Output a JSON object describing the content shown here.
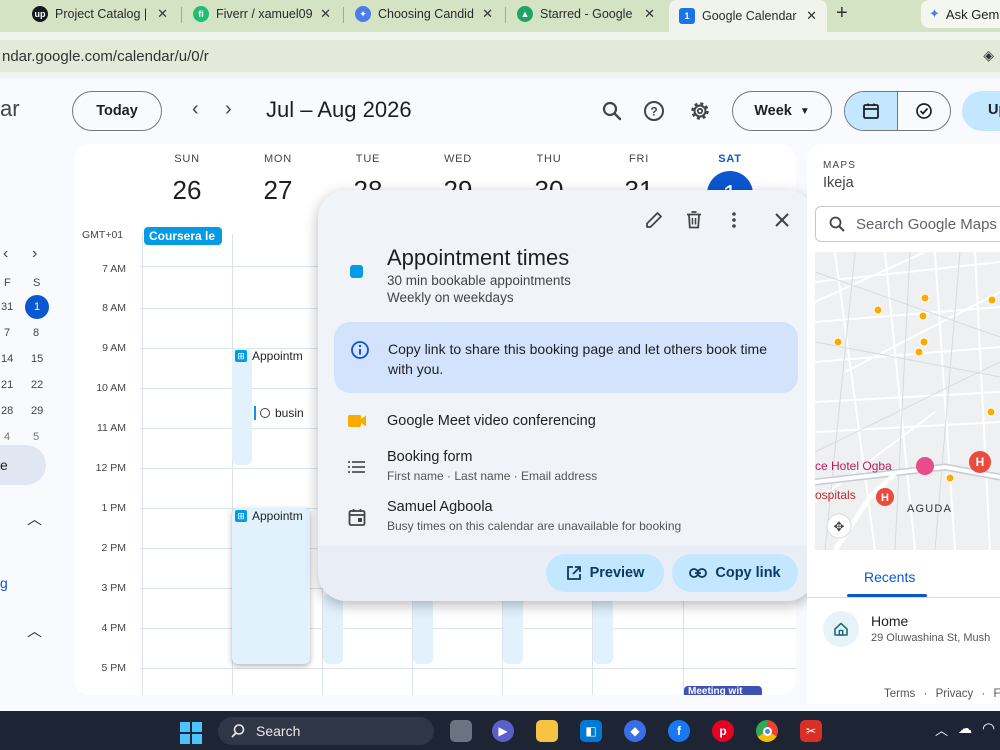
{
  "browser": {
    "tabs": [
      {
        "title": "Project Catalog |",
        "favicon": "upwork-icon",
        "color": "#14181c",
        "glyph": "up"
      },
      {
        "title": "Fiverr / xamuel09",
        "favicon": "fiverr-icon",
        "color": "#1dbf73",
        "glyph": "fi"
      },
      {
        "title": "Choosing Candid",
        "favicon": "gemini-icon",
        "color": "#4b7bec",
        "glyph": "✦"
      },
      {
        "title": "Starred - Google",
        "favicon": "google-drive-icon",
        "color": "#1fa463",
        "glyph": "▲"
      },
      {
        "title": "Google Calendar",
        "favicon": "google-calendar-icon",
        "color": "#1a73e8",
        "glyph": "1"
      }
    ],
    "close_glyph": "✕",
    "new_tab_glyph": "+",
    "gemini_button": "Ask Gem",
    "url": "ndar.google.com/calendar/u/0/r"
  },
  "calendar": {
    "brand_fragment": "ar",
    "today_label": "Today",
    "prev_glyph": "‹",
    "next_glyph": "›",
    "date_range": "Jul – Aug 2026",
    "view_label": "Week",
    "create_fragment": "Up",
    "timezone": "GMT+01",
    "days": [
      {
        "name": "SUN",
        "date": "26"
      },
      {
        "name": "MON",
        "date": "27"
      },
      {
        "name": "TUE",
        "date": "28"
      },
      {
        "name": "WED",
        "date": "29"
      },
      {
        "name": "THU",
        "date": "30"
      },
      {
        "name": "FRI",
        "date": "31"
      },
      {
        "name": "SAT",
        "date": "1"
      }
    ],
    "allday_event": "Coursera le",
    "times": [
      "7 AM",
      "8 AM",
      "9 AM",
      "10 AM",
      "11 AM",
      "12 PM",
      "1 PM",
      "2 PM",
      "3 PM",
      "4 PM",
      "5 PM"
    ],
    "events": {
      "appt_morning": "Appointm",
      "business": "busin",
      "appt_afternoon": "Appointm",
      "meeting": "Meeting wit"
    }
  },
  "mini_calendar": {
    "prev": "‹",
    "next": "›",
    "col_f": "F",
    "col_s": "S",
    "rows": [
      [
        "31",
        "1"
      ],
      [
        "7",
        "8"
      ],
      [
        "14",
        "15"
      ],
      [
        "21",
        "22"
      ],
      [
        "28",
        "29"
      ],
      [
        "4",
        "5"
      ]
    ],
    "selected_fragment": "e",
    "link_fragment": "g"
  },
  "popover": {
    "title": "Appointment times",
    "duration": "30 min bookable appointments",
    "recurrence": "Weekly on weekdays",
    "info": "Copy link to share this booking page and let others book time with you.",
    "meet": "Google Meet video conferencing",
    "form_title": "Booking form",
    "form_fields": "First name · Last name · Email address",
    "owner": "Samuel Agboola",
    "owner_note": "Busy times on this calendar are unavailable for booking",
    "preview_label": "Preview",
    "copy_label": "Copy link",
    "color": "#039be5"
  },
  "maps": {
    "label": "MAPS",
    "location": "Ikeja",
    "search_placeholder": "Search Google Maps",
    "place_hotel": "ce Hotel Ogba",
    "place_hospital": "ospitals",
    "place_area": "AGUDA",
    "recents_tab": "Recents",
    "home_title": "Home",
    "home_address": "29 Oluwashina St, Mush",
    "footer_terms": "Terms",
    "footer_sep": "·",
    "footer_privacy": "Privacy",
    "footer_more": "F"
  },
  "taskbar": {
    "search_label": "Search"
  }
}
